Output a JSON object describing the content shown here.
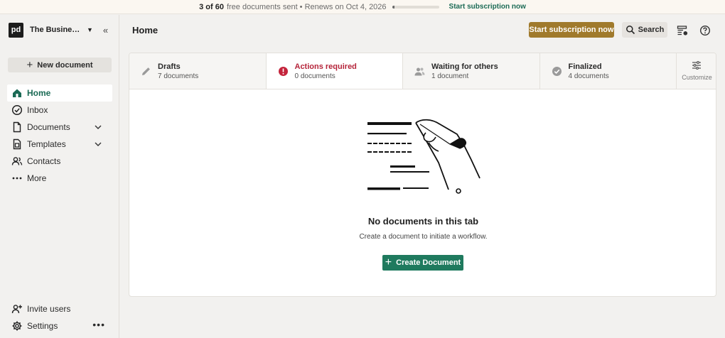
{
  "banner": {
    "count": "3 of 60",
    "text": "free documents sent • Renews on Oct 4, 2026",
    "progress": 0.05,
    "cta": "Start subscription now"
  },
  "sidebar": {
    "brand_logo": "pd",
    "brand_name": "The Business ...",
    "new_document": "New document",
    "items": [
      {
        "label": "Home",
        "icon": "home-icon",
        "active": true
      },
      {
        "label": "Inbox",
        "icon": "check-circle-icon"
      },
      {
        "label": "Documents",
        "icon": "document-icon",
        "expandable": true
      },
      {
        "label": "Templates",
        "icon": "template-icon",
        "expandable": true
      },
      {
        "label": "Contacts",
        "icon": "contacts-icon"
      },
      {
        "label": "More",
        "icon": "more-dots-icon"
      }
    ],
    "bottom": [
      {
        "label": "Invite users",
        "icon": "add-user-icon"
      },
      {
        "label": "Settings",
        "icon": "gear-icon"
      }
    ]
  },
  "header": {
    "title": "Home",
    "start_subscription": "Start subscription now",
    "search": "Search"
  },
  "tabs": [
    {
      "label": "Drafts",
      "count": "7 documents",
      "icon": "pencil-icon"
    },
    {
      "label": "Actions required",
      "count": "0 documents",
      "icon": "alert-icon",
      "active": true
    },
    {
      "label": "Waiting for others",
      "count": "1 document",
      "icon": "people-icon"
    },
    {
      "label": "Finalized",
      "count": "4 documents",
      "icon": "check-badge-icon"
    }
  ],
  "customize": "Customize",
  "empty_state": {
    "title": "No documents in this tab",
    "subtitle": "Create a document to initiate a workflow.",
    "button": "Create Document"
  },
  "colors": {
    "accent_green": "#1f7a5e",
    "gold": "#a07a2c",
    "alert_red": "#b5243a"
  }
}
